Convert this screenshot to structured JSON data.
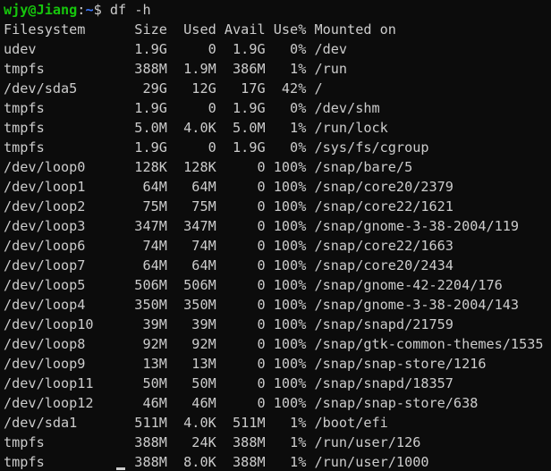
{
  "prompt": {
    "user_host": "wjy@Jiang",
    "separator": ":",
    "cwd": "~",
    "symbol": "$",
    "command": " df -h"
  },
  "headers": [
    "Filesystem",
    "Size",
    "Used",
    "Avail",
    "Use%",
    "Mounted on"
  ],
  "rows": [
    [
      "udev",
      "1.9G",
      "0",
      "1.9G",
      "0%",
      "/dev"
    ],
    [
      "tmpfs",
      "388M",
      "1.9M",
      "386M",
      "1%",
      "/run"
    ],
    [
      "/dev/sda5",
      "29G",
      "12G",
      "17G",
      "42%",
      "/"
    ],
    [
      "tmpfs",
      "1.9G",
      "0",
      "1.9G",
      "0%",
      "/dev/shm"
    ],
    [
      "tmpfs",
      "5.0M",
      "4.0K",
      "5.0M",
      "1%",
      "/run/lock"
    ],
    [
      "tmpfs",
      "1.9G",
      "0",
      "1.9G",
      "0%",
      "/sys/fs/cgroup"
    ],
    [
      "/dev/loop0",
      "128K",
      "128K",
      "0",
      "100%",
      "/snap/bare/5"
    ],
    [
      "/dev/loop1",
      "64M",
      "64M",
      "0",
      "100%",
      "/snap/core20/2379"
    ],
    [
      "/dev/loop2",
      "75M",
      "75M",
      "0",
      "100%",
      "/snap/core22/1621"
    ],
    [
      "/dev/loop3",
      "347M",
      "347M",
      "0",
      "100%",
      "/snap/gnome-3-38-2004/119"
    ],
    [
      "/dev/loop6",
      "74M",
      "74M",
      "0",
      "100%",
      "/snap/core22/1663"
    ],
    [
      "/dev/loop7",
      "64M",
      "64M",
      "0",
      "100%",
      "/snap/core20/2434"
    ],
    [
      "/dev/loop5",
      "506M",
      "506M",
      "0",
      "100%",
      "/snap/gnome-42-2204/176"
    ],
    [
      "/dev/loop4",
      "350M",
      "350M",
      "0",
      "100%",
      "/snap/gnome-3-38-2004/143"
    ],
    [
      "/dev/loop10",
      "39M",
      "39M",
      "0",
      "100%",
      "/snap/snapd/21759"
    ],
    [
      "/dev/loop8",
      "92M",
      "92M",
      "0",
      "100%",
      "/snap/gtk-common-themes/1535"
    ],
    [
      "/dev/loop9",
      "13M",
      "13M",
      "0",
      "100%",
      "/snap/snap-store/1216"
    ],
    [
      "/dev/loop11",
      "50M",
      "50M",
      "0",
      "100%",
      "/snap/snapd/18357"
    ],
    [
      "/dev/loop12",
      "46M",
      "46M",
      "0",
      "100%",
      "/snap/snap-store/638"
    ],
    [
      "/dev/sda1",
      "511M",
      "4.0K",
      "511M",
      "1%",
      "/boot/efi"
    ],
    [
      "tmpfs",
      "388M",
      "24K",
      "388M",
      "1%",
      "/run/user/126"
    ],
    [
      "tmpfs",
      "388M",
      "8.0K",
      "388M",
      "1%",
      "/run/user/1000"
    ]
  ],
  "colors": {
    "background": "#0c0c0c",
    "text": "#cccccc",
    "user_host": "#16c60c",
    "path": "#3b78ff"
  }
}
